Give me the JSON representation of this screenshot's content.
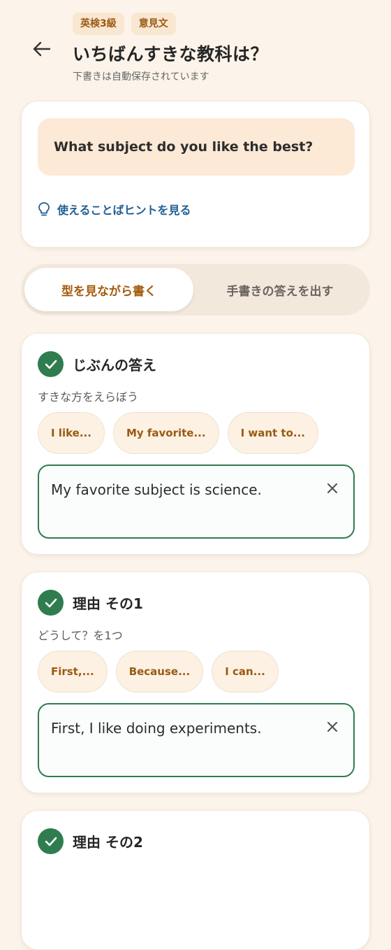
{
  "header": {
    "tags": [
      "英検3級",
      "意見文"
    ],
    "title": "いちばんすきな教科は？",
    "save_status": "下書きは自動保存されています"
  },
  "prompt": {
    "question": "What subject do you like the best?",
    "hint_label": "使えることばヒントを見る"
  },
  "mode_toggle": {
    "active_label": "型を見ながら書く",
    "inactive_label": "手書きの答えを出す"
  },
  "steps": [
    {
      "title": "じぶんの答え",
      "subtitle": "すきな方をえらぼう",
      "chips": [
        "I like...",
        "My favorite...",
        "I want to..."
      ],
      "answer": "My favorite subject is science."
    },
    {
      "title": "理由 その1",
      "subtitle": "どうして？を1つ",
      "chips": [
        "First,...",
        "Because...",
        "I can..."
      ],
      "answer": "First, I like doing experiments."
    },
    {
      "title": "理由 その2"
    }
  ],
  "colors": {
    "background": "#fcf4ea",
    "accent_orange": "#9a5a12",
    "accent_green": "#2f7d4f",
    "link_blue": "#1f5f93"
  }
}
